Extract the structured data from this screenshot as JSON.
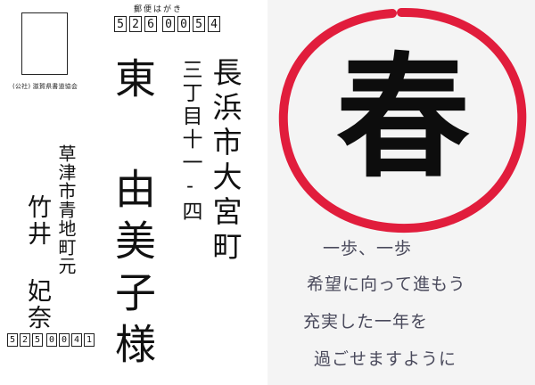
{
  "postcard": {
    "header": "郵便はがき",
    "stamp_caption": "(公社) 滋賀県書道協会",
    "recipient_postal_digits": [
      "5",
      "2",
      "6",
      "0",
      "0",
      "5",
      "4"
    ],
    "recipient_address_city": "長浜市大宮町",
    "recipient_address_block": "三丁目十一-四",
    "recipient_name": "東 由美子様",
    "sender_address": "草津市青地町元",
    "sender_name": "竹井 妃奈",
    "sender_postal_digits": [
      "5",
      "2",
      "5",
      "0",
      "0",
      "4",
      "1"
    ]
  },
  "card": {
    "kanji": "春",
    "circle_color": "#e11d3c",
    "message_lines": [
      "一歩、一歩",
      "希望に向って進もう",
      "充実した一年を",
      "過ごせますように"
    ]
  }
}
